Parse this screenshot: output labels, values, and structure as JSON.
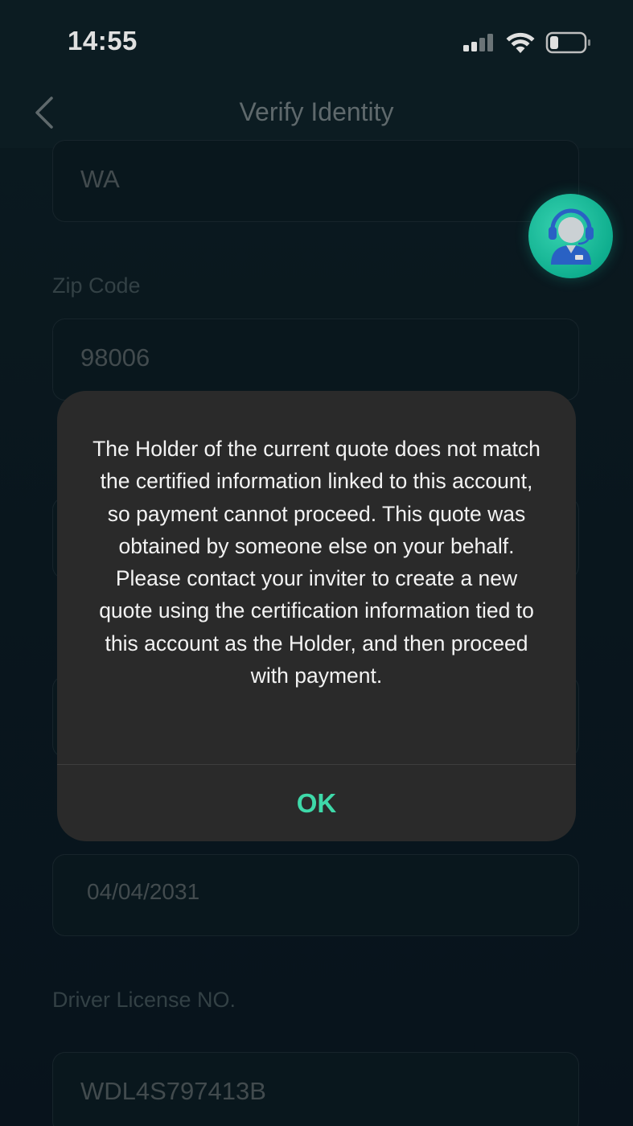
{
  "status_bar": {
    "time": "14:55"
  },
  "header": {
    "title": "Verify Identity"
  },
  "form": {
    "state_value": "WA",
    "zip_label": "Zip Code",
    "zip_value": "98006",
    "expiry_value": "04/04/2031",
    "license_label": "Driver License NO.",
    "license_value": "WDL4S797413B"
  },
  "dialog": {
    "message": "The Holder of the current quote does not match the certified information linked to this account, so payment cannot proceed. This quote was obtained by someone else on your behalf. Please contact your inviter to create a new quote using the certification information tied to this account as the Holder, and then proceed with payment.",
    "ok_label": "OK"
  },
  "colors": {
    "accent": "#3ed9a9",
    "dialog_bg": "#2a2a2a",
    "page_bg": "#0d1e25"
  },
  "icons": [
    "signal-icon",
    "wifi-icon",
    "battery-icon",
    "back-chevron-icon",
    "customer-support-icon"
  ]
}
